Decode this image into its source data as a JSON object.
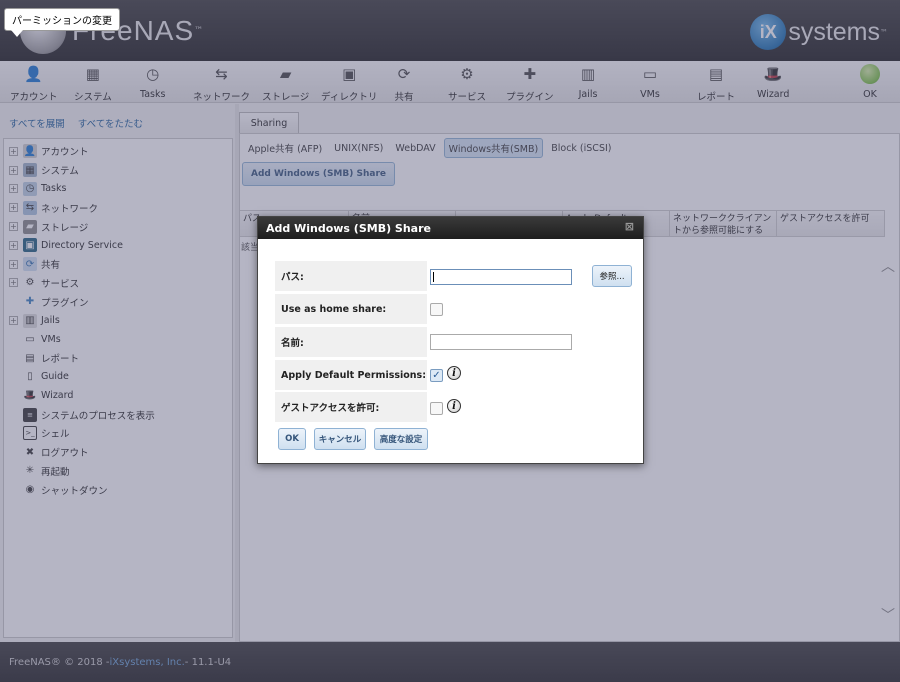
{
  "tooltip": "パーミッションの変更",
  "header": {
    "logo_text": "FreeNAS",
    "logo_tm": "™",
    "ix_mark": "iX",
    "ix_text": "systems",
    "ix_tm": "™"
  },
  "toolbar": [
    {
      "label": "アカウント",
      "icon": "account-icon",
      "color": "#8a8a8a"
    },
    {
      "label": "システム",
      "icon": "system-icon",
      "color": "#5a7390"
    },
    {
      "label": "Tasks",
      "icon": "tasks-icon",
      "color": "#6c8fb3"
    },
    {
      "label": "ネットワーク",
      "icon": "network-icon",
      "color": "#4d7fb0"
    },
    {
      "label": "ストレージ",
      "icon": "storage-icon",
      "color": "#444444"
    },
    {
      "label": "ディレクトリ",
      "icon": "directory-icon",
      "color": "#1f5f7f"
    },
    {
      "label": "共有",
      "icon": "sharing-icon",
      "color": "#2f6fb0"
    },
    {
      "label": "サービス",
      "icon": "services-icon",
      "color": "#555555"
    },
    {
      "label": "プラグイン",
      "icon": "plugins-icon",
      "color": "#777777"
    },
    {
      "label": "Jails",
      "icon": "jails-icon",
      "color": "#777777"
    },
    {
      "label": "VMs",
      "icon": "vms-icon",
      "color": "#333333"
    },
    {
      "label": "レポート",
      "icon": "reporting-icon",
      "color": "#c7c7c7"
    },
    {
      "label": "Wizard",
      "icon": "wizard-icon",
      "color": "#333333"
    },
    {
      "label": "OK",
      "icon": "alert-ok-icon",
      "color": "#7ac142"
    }
  ],
  "nav": {
    "expand_all": "すべてを展開",
    "collapse_all": "すべてをたたむ",
    "items": [
      {
        "label": "アカウント",
        "expandable": true,
        "icon": "account-icon"
      },
      {
        "label": "システム",
        "expandable": true,
        "icon": "system-icon"
      },
      {
        "label": "Tasks",
        "expandable": true,
        "icon": "tasks-icon"
      },
      {
        "label": "ネットワーク",
        "expandable": true,
        "icon": "network-icon"
      },
      {
        "label": "ストレージ",
        "expandable": true,
        "icon": "storage-icon"
      },
      {
        "label": "Directory Service",
        "expandable": true,
        "icon": "directory-icon"
      },
      {
        "label": "共有",
        "expandable": true,
        "icon": "sharing-icon"
      },
      {
        "label": "サービス",
        "expandable": true,
        "icon": "services-icon"
      },
      {
        "label": "プラグイン",
        "expandable": false,
        "icon": "plugins-icon"
      },
      {
        "label": "Jails",
        "expandable": true,
        "icon": "jails-icon"
      },
      {
        "label": "VMs",
        "expandable": false,
        "icon": "vms-icon"
      },
      {
        "label": "レポート",
        "expandable": false,
        "icon": "reporting-icon"
      },
      {
        "label": "Guide",
        "expandable": false,
        "icon": "guide-icon"
      },
      {
        "label": "Wizard",
        "expandable": false,
        "icon": "wizard-icon"
      },
      {
        "label": "システムのプロセスを表示",
        "expandable": false,
        "icon": "processes-icon"
      },
      {
        "label": "シェル",
        "expandable": false,
        "icon": "shell-icon"
      },
      {
        "label": "ログアウト",
        "expandable": false,
        "icon": "logout-icon"
      },
      {
        "label": "再起動",
        "expandable": false,
        "icon": "reboot-icon"
      },
      {
        "label": "シャットダウン",
        "expandable": false,
        "icon": "shutdown-icon"
      }
    ]
  },
  "main": {
    "tab": "Sharing",
    "subtabs": [
      "Apple共有 (AFP)",
      "UNIX(NFS)",
      "WebDAV",
      "Windows共有(SMB)",
      "Block (iSCSI)"
    ],
    "active_subtab": 3,
    "add_button": "Add Windows (SMB) Share",
    "grid_columns": [
      "パス",
      "名前",
      "",
      "Apply Default Permissions",
      "ネットワーククライアントから参照可能にする",
      "ゲストアクセスを許可"
    ],
    "grid_empty_text": "該当"
  },
  "footer": {
    "copyright": "FreeNAS® © 2018 - ",
    "company": "iXsystems, Inc.",
    "version": " - 11.1-U4"
  },
  "dialog": {
    "title": "Add Windows (SMB) Share",
    "close": "⊠",
    "fields": {
      "path_label": "パス:",
      "path_value": "",
      "browse": "参照...",
      "home_label": "Use as home share:",
      "home_checked": false,
      "name_label": "名前:",
      "name_value": "",
      "perm_label": "Apply Default Permissions:",
      "perm_checked": true,
      "guest_label": "ゲストアクセスを許可:",
      "guest_checked": false
    },
    "buttons": {
      "ok": "OK",
      "cancel": "キャンセル",
      "advanced": "高度な設定"
    }
  }
}
